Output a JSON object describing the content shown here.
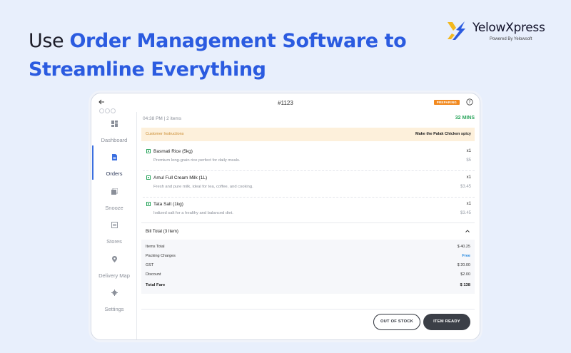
{
  "headline": {
    "line1_prefix": "Use ",
    "line1_highlight": "Order Management Software to",
    "line2_highlight": "Streamline Everything"
  },
  "brand": {
    "name": "YelowXpress",
    "tagline": "Powered By Yelowsoft"
  },
  "colors": {
    "accent": "#2b5be0",
    "badge": "#f28a20",
    "timer": "#2aa55c",
    "instructions_bg": "#fdf0db"
  },
  "topbar": {
    "order_number": "#1123",
    "status": "PREPARING",
    "back_icon": "back-arrow-icon",
    "help_icon": "help-icon"
  },
  "sidebar": {
    "items": [
      {
        "label": "Dashboard",
        "icon": "dashboard-icon",
        "active": false
      },
      {
        "label": "Orders",
        "icon": "document-icon",
        "active": true
      },
      {
        "label": "Snooze",
        "icon": "snooze-icon",
        "active": false
      },
      {
        "label": "Stores",
        "icon": "store-icon",
        "active": false
      },
      {
        "label": "Delivery Map",
        "icon": "map-pin-icon",
        "active": false
      },
      {
        "label": "Settings",
        "icon": "gear-icon",
        "active": false
      }
    ]
  },
  "order": {
    "meta": "04:38 PM | 2 items",
    "timer": "32 MINS",
    "instructions_label": "Customer Instructions",
    "instructions_text": "Make the Palak Chicken spicy",
    "items": [
      {
        "name": "Basmati Rice (5kg)",
        "desc": "Premium long-grain rice perfect for daily meals.",
        "qty": "x1",
        "price": "$5"
      },
      {
        "name": "Amul Full Cream Milk (1L)",
        "desc": "Fresh and pure milk, ideal for tea, coffee, and cooking.",
        "qty": "x1",
        "price": "$3.45"
      },
      {
        "name": "Tata Salt (1kg)",
        "desc": "Iodized salt for a healthy and balanced diet.",
        "qty": "x1",
        "price": "$3.45"
      }
    ]
  },
  "bill": {
    "title": "Bill Total (3 Item)",
    "rows": [
      {
        "label": "Items Total",
        "value": "$ 40.25"
      },
      {
        "label": "Packing Charges",
        "value": "Free"
      },
      {
        "label": "GST",
        "value": "$ 20.00"
      },
      {
        "label": "Discount",
        "value": "$2.00"
      }
    ],
    "total_label": "Total Fare",
    "total_value": "$ 138"
  },
  "actions": {
    "out_of_stock": "OUT OF STOCK",
    "item_ready": "ITEM READY"
  }
}
